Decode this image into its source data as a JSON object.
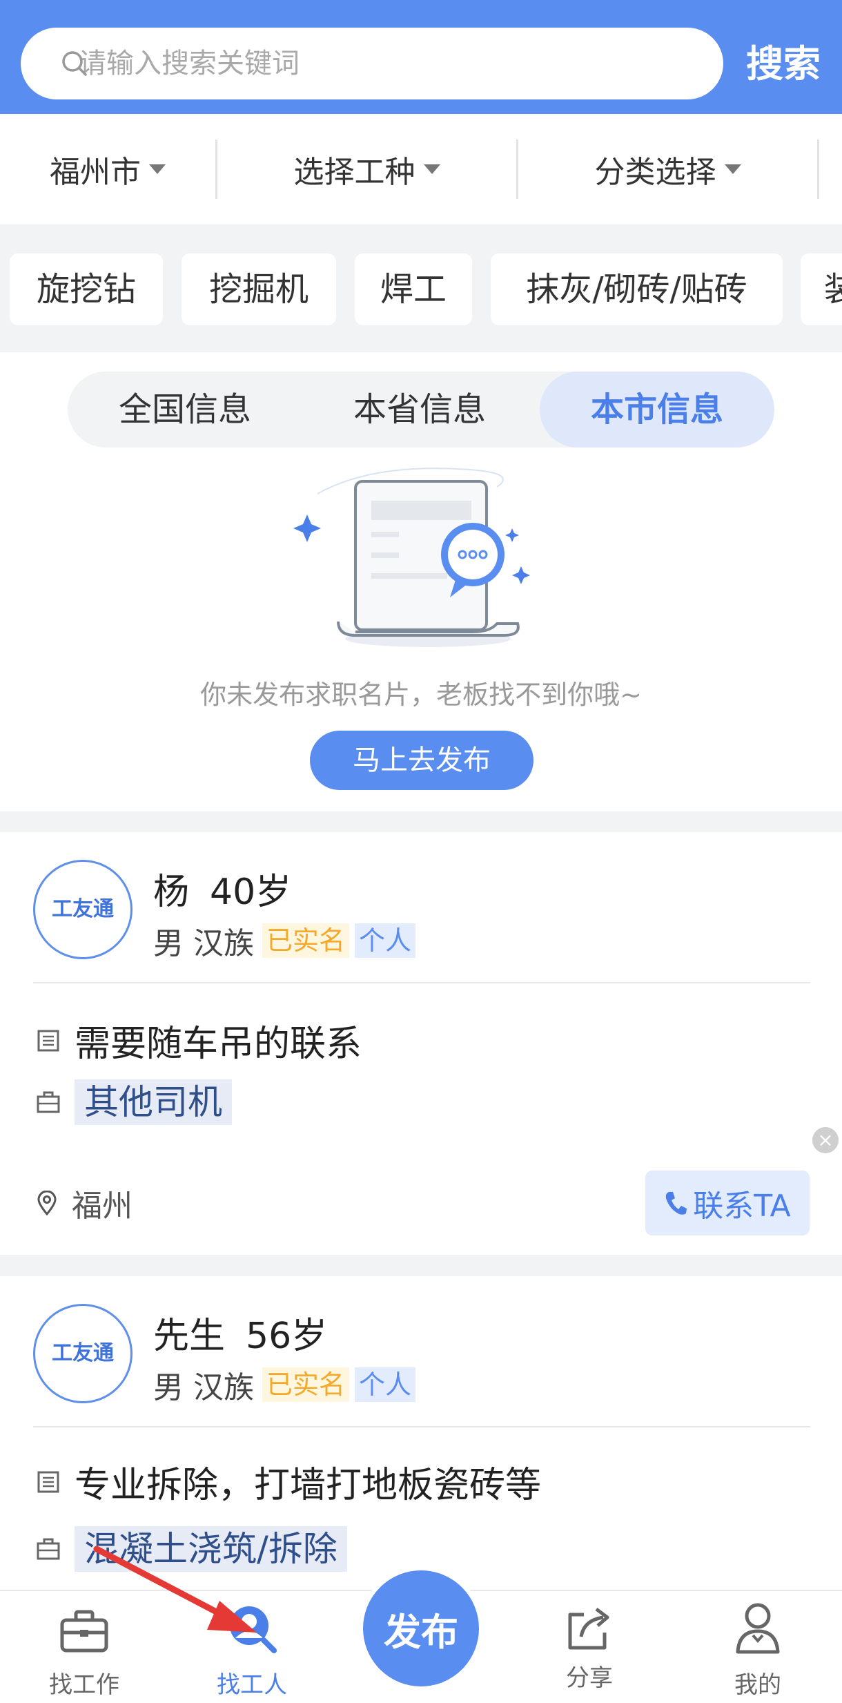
{
  "search": {
    "placeholder": "请输入搜索关键词",
    "button_label": "搜索"
  },
  "filters": [
    {
      "label": "福州市"
    },
    {
      "label": "选择工种"
    },
    {
      "label": "分类选择"
    }
  ],
  "tags": [
    "旋挖钻",
    "挖掘机",
    "焊工",
    "抹灰/砌砖/贴砖",
    "装"
  ],
  "scope_tabs": [
    {
      "label": "全国信息",
      "active": false
    },
    {
      "label": "本省信息",
      "active": false
    },
    {
      "label": "本市信息",
      "active": true
    }
  ],
  "empty_state": {
    "message": "你未发布求职名片，老板找不到你哦~",
    "button_label": "马上去发布"
  },
  "workers": [
    {
      "logo_text": "工友通",
      "name": "杨",
      "age": "40岁",
      "gender": "男",
      "ethnicity": "汉族",
      "verified_badge": "已实名",
      "type_badge": "个人",
      "description": "需要随车吊的联系",
      "category": "其他司机",
      "location": "福州",
      "contact_label": "联系TA"
    },
    {
      "logo_text": "工友通",
      "name": "先生",
      "age": "56岁",
      "gender": "男",
      "ethnicity": "汉族",
      "verified_badge": "已实名",
      "type_badge": "个人",
      "description": "专业拆除，打墙打地板瓷砖等",
      "category": "混凝土浇筑/拆除"
    }
  ],
  "close_ad_symbol": "×",
  "bottom_nav": {
    "items": [
      {
        "label": "找工作",
        "icon": "briefcase-icon",
        "active": false
      },
      {
        "label": "找工人",
        "icon": "person-search-icon",
        "active": true
      },
      {
        "label": "分享",
        "icon": "share-icon",
        "active": false
      },
      {
        "label": "我的",
        "icon": "user-icon",
        "active": false
      }
    ],
    "publish_label": "发布"
  },
  "colors": {
    "primary": "#5a8df0",
    "active_text": "#4a7ee8",
    "verified": "#f4a92a",
    "annotation_arrow": "#e53935"
  }
}
